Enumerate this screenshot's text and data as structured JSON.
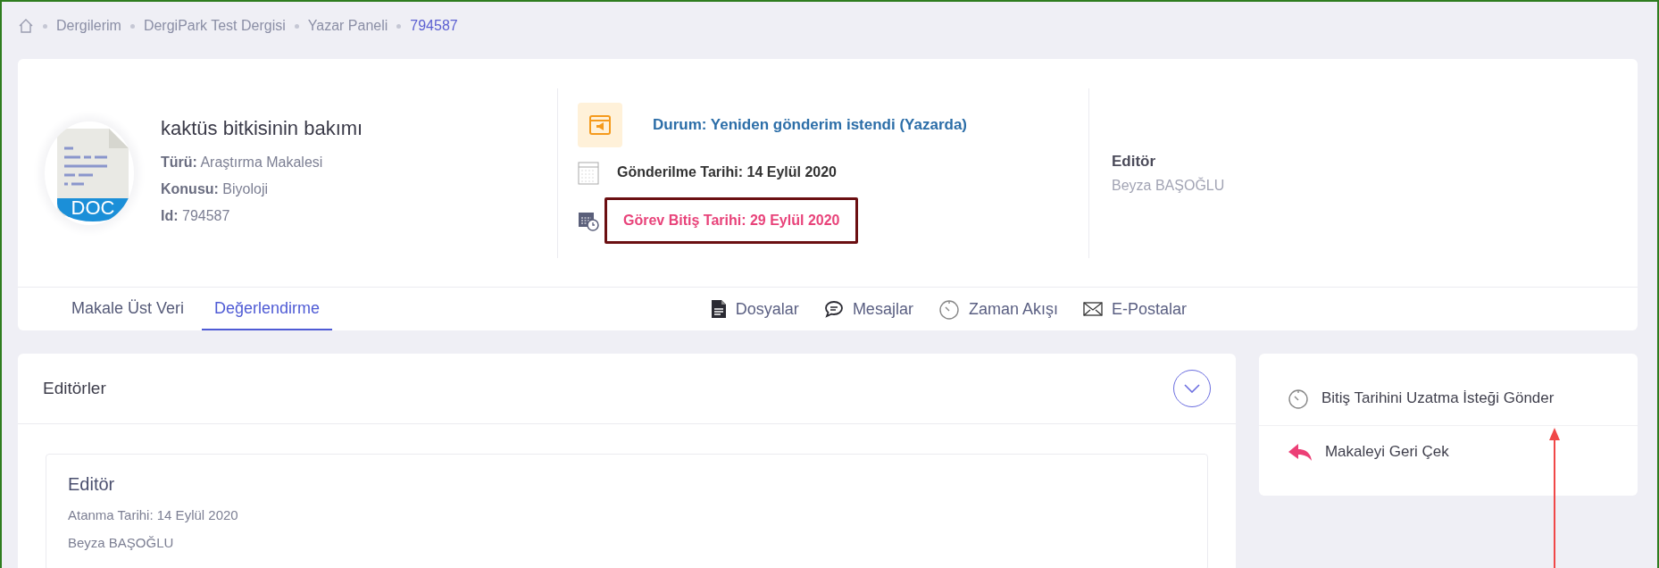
{
  "breadcrumb": [
    {
      "label": "Dergilerim",
      "current": false
    },
    {
      "label": "DergiPark Test Dergisi",
      "current": false
    },
    {
      "label": "Yazar Paneli",
      "current": false
    },
    {
      "label": "794587",
      "current": true
    }
  ],
  "article": {
    "file_type": "DOC",
    "title": "kaktüs bitkisinin bakımı",
    "fields": [
      {
        "label": "Türü:",
        "value": "Araştırma Makalesi"
      },
      {
        "label": "Konusu:",
        "value": "Biyoloji"
      },
      {
        "label": "Id:",
        "value": "794587"
      }
    ]
  },
  "status": {
    "text": "Durum: Yeniden gönderim istendi (Yazarda)",
    "submitted": "Gönderilme Tarihi: 14 Eylül 2020",
    "deadline": "Görev Bitiş Tarihi: 29 Eylül 2020",
    "deadline_highlighted": true
  },
  "editor_summary": {
    "label": "Editör",
    "name": "Beyza BAŞOĞLU"
  },
  "tabs": [
    {
      "label": "Makale Üst Veri",
      "selected": false
    },
    {
      "label": "Değerlendirme",
      "selected": true
    }
  ],
  "links": [
    {
      "label": "Dosyalar",
      "kind": "file"
    },
    {
      "label": "Mesajlar",
      "kind": "chat"
    },
    {
      "label": "Zaman Akışı",
      "kind": "timer"
    },
    {
      "label": "E-Postalar",
      "kind": "mail"
    }
  ],
  "editors_panel": {
    "title": "Editörler",
    "editor": {
      "role": "Editör",
      "assigned": "Atanma Tarihi: 14 Eylül 2020",
      "name": "Beyza BAŞOĞLU"
    }
  },
  "actions": [
    {
      "label": "Bitiş Tarihini Uzatma İsteği Gönder",
      "kind": "timer"
    },
    {
      "label": "Makaleyi Geri Çek",
      "kind": "undo"
    }
  ],
  "annotation_arrow": true
}
